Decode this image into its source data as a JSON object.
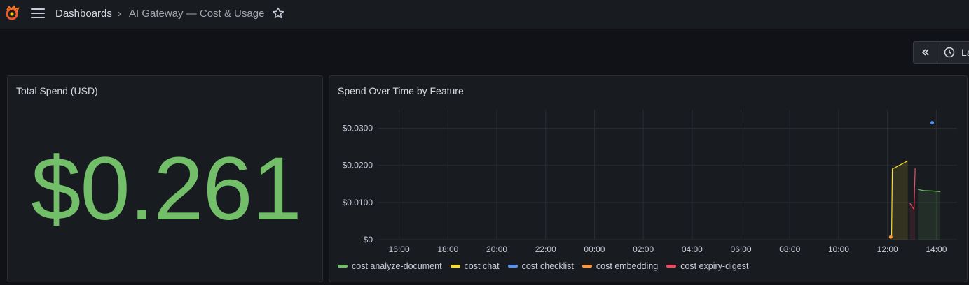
{
  "header": {
    "breadcrumb_root": "Dashboards",
    "separator": "›",
    "current": "AI Gateway — Cost & Usage",
    "time_label": "La"
  },
  "panels": {
    "total_spend": {
      "title": "Total Spend (USD)",
      "value": "$0.261",
      "color": "#73bf69"
    },
    "spend_over_time": {
      "title": "Spend Over Time by Feature"
    }
  },
  "chart_data": {
    "type": "line",
    "title": "Spend Over Time by Feature",
    "xlabel": "",
    "ylabel": "",
    "x_ticks": [
      "16:00",
      "18:00",
      "20:00",
      "22:00",
      "00:00",
      "02:00",
      "04:00",
      "06:00",
      "08:00",
      "10:00",
      "12:00",
      "14:00"
    ],
    "y_ticks": [
      "$0",
      "$0.0100",
      "$0.0200",
      "$0.0300"
    ],
    "ylim": [
      0,
      0.035
    ],
    "xlim_hours": [
      14.5,
      14.5
    ],
    "grid": true,
    "legend_position": "bottom",
    "series": [
      {
        "name": "cost analyze-document",
        "color": "#73bf69",
        "points": [
          [
            "13:15",
            0.0135
          ],
          [
            "13:30",
            0.0132
          ],
          [
            "13:50",
            0.0131
          ],
          [
            "14:10",
            0.0129
          ]
        ]
      },
      {
        "name": "cost chat",
        "color": "#fade2a",
        "points": [
          [
            "12:10",
            0.0005
          ],
          [
            "12:12",
            0.019
          ],
          [
            "12:50",
            0.0212
          ]
        ]
      },
      {
        "name": "cost checklist",
        "color": "#5794f2",
        "points": [
          [
            "13:50",
            0.0315
          ]
        ]
      },
      {
        "name": "cost embedding",
        "color": "#ff9830",
        "points": [
          [
            "12:08",
            0.0007
          ]
        ]
      },
      {
        "name": "cost expiry-digest",
        "color": "#f2495c",
        "points": [
          [
            "12:55",
            0.0098
          ],
          [
            "13:05",
            0.0082
          ],
          [
            "13:08",
            0.0192
          ]
        ]
      }
    ]
  }
}
